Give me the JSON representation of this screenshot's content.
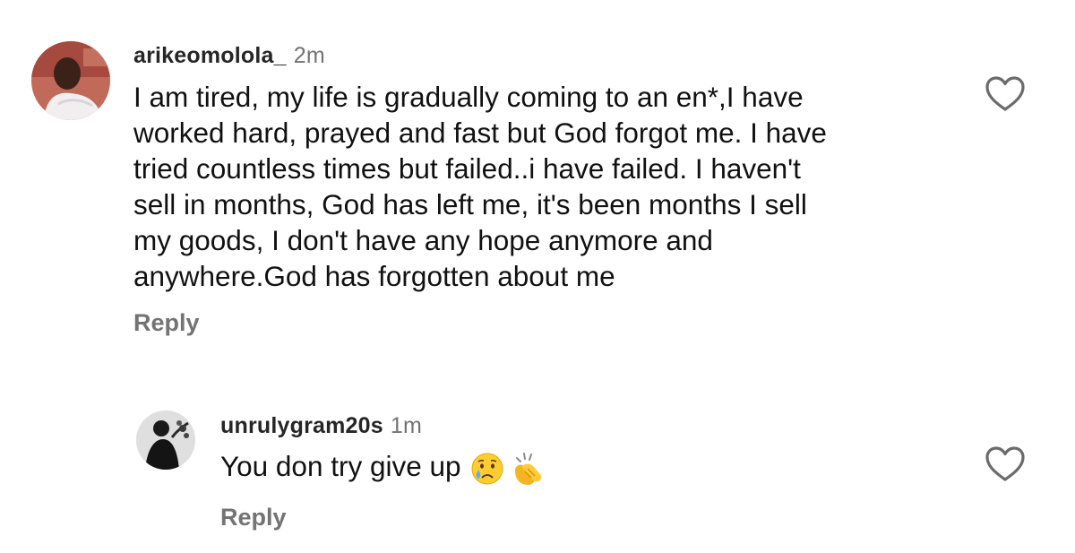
{
  "comments": [
    {
      "username": "arikeomolola_",
      "timestamp": "2m",
      "lines": [
        "I am tired, my life is gradually coming to an en*,I  have",
        "worked hard, prayed and fast but God forgot me. I have",
        "tried countless times but failed..i have failed. I haven't",
        "sell in months, God has left me, it's been months I sell",
        "my goods, I don't have any hope anymore and",
        "anywhere.God has forgotten about me"
      ],
      "reply_label": "Reply",
      "like_icon": "heart-outline-icon"
    }
  ],
  "replies": [
    {
      "username": "unrulygram20s",
      "timestamp": "1m",
      "text": "You don try give up",
      "emojis": [
        "crying-face-emoji",
        "clapping-hands-emoji"
      ],
      "reply_label": "Reply",
      "like_icon": "heart-outline-icon"
    }
  ],
  "colors": {
    "username": "#262626",
    "text": "#111111",
    "muted": "#737373",
    "icon": "#6b6b6b"
  }
}
